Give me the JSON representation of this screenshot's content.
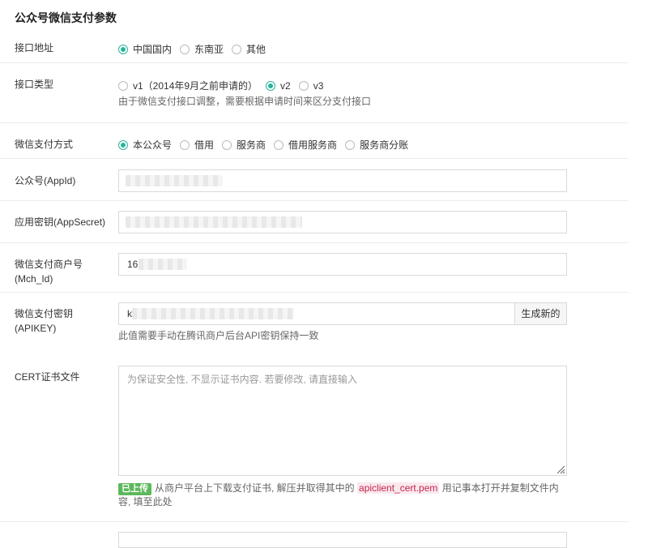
{
  "page_title": "公众号微信支付参数",
  "rows": {
    "address": {
      "label": "接口地址",
      "options": [
        "中国国内",
        "东南亚",
        "其他"
      ],
      "selected": 0
    },
    "type": {
      "label": "接口类型",
      "options": [
        "v1（2014年9月之前申请的）",
        "v2",
        "v3"
      ],
      "selected": 1,
      "help": "由于微信支付接口调整，需要根据申请时间来区分支付接口"
    },
    "pay_mode": {
      "label": "微信支付方式",
      "options": [
        "本公众号",
        "借用",
        "服务商",
        "借用服务商",
        "服务商分账"
      ],
      "selected": 0
    },
    "appid": {
      "label": "公众号(AppId)",
      "value": ""
    },
    "appsecret": {
      "label": "应用密钥(AppSecret)",
      "value": ""
    },
    "mchid": {
      "label_line1": "微信支付商户号",
      "label_line2": "(Mch_Id)",
      "value": "16"
    },
    "apikey": {
      "label_line1": "微信支付密钥",
      "label_line2": "(APIKEY)",
      "value": "k",
      "generate_button": "生成新的",
      "help": "此值需要手动在腾讯商户后台API密钥保持一致"
    },
    "cert": {
      "label": "CERT证书文件",
      "placeholder": "为保证安全性, 不显示证书内容. 若要修改, 请直接输入",
      "badge": "已上传",
      "help_before": "从商户平台上下载支付证书, 解压并取得其中的",
      "help_code": "apiclient_cert.pem",
      "help_after": "用记事本打开并复制文件内容, 填至此处"
    }
  },
  "colors": {
    "accent": "#2bb39b",
    "badge": "#5cb85c",
    "code_text": "#c7254e"
  }
}
